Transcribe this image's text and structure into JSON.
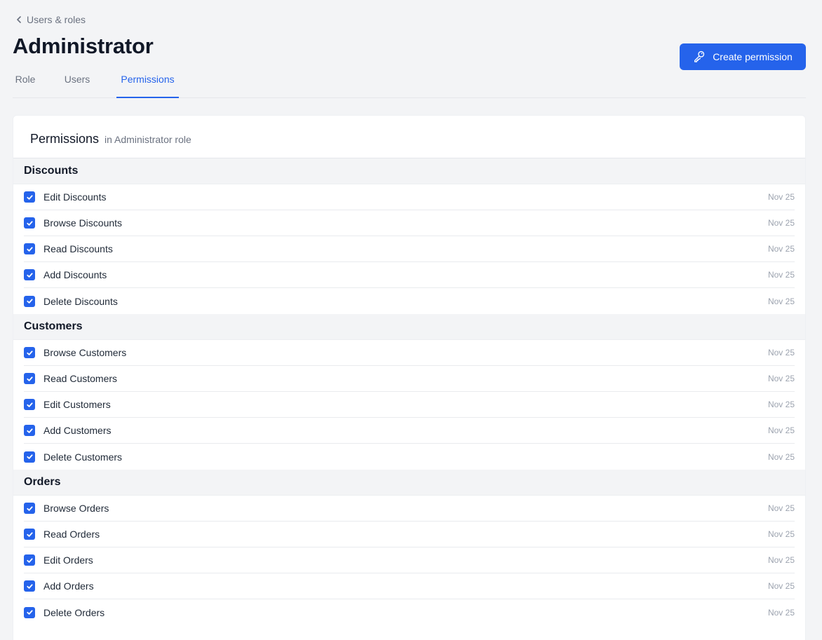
{
  "breadcrumb": {
    "label": "Users & roles"
  },
  "header": {
    "title": "Administrator",
    "create_button_label": "Create permission"
  },
  "tabs": [
    {
      "label": "Role",
      "active": false
    },
    {
      "label": "Users",
      "active": false
    },
    {
      "label": "Permissions",
      "active": true
    }
  ],
  "card": {
    "title": "Permissions",
    "subtitle": "in Administrator role"
  },
  "accent_color": "#2563eb",
  "groups": [
    {
      "name": "Discounts",
      "permissions": [
        {
          "label": "Edit Discounts",
          "date": "Nov 25",
          "checked": true
        },
        {
          "label": "Browse Discounts",
          "date": "Nov 25",
          "checked": true
        },
        {
          "label": "Read Discounts",
          "date": "Nov 25",
          "checked": true
        },
        {
          "label": "Add Discounts",
          "date": "Nov 25",
          "checked": true
        },
        {
          "label": "Delete Discounts",
          "date": "Nov 25",
          "checked": true
        }
      ]
    },
    {
      "name": "Customers",
      "permissions": [
        {
          "label": "Browse Customers",
          "date": "Nov 25",
          "checked": true
        },
        {
          "label": "Read Customers",
          "date": "Nov 25",
          "checked": true
        },
        {
          "label": "Edit Customers",
          "date": "Nov 25",
          "checked": true
        },
        {
          "label": "Add Customers",
          "date": "Nov 25",
          "checked": true
        },
        {
          "label": "Delete Customers",
          "date": "Nov 25",
          "checked": true
        }
      ]
    },
    {
      "name": "Orders",
      "permissions": [
        {
          "label": "Browse Orders",
          "date": "Nov 25",
          "checked": true
        },
        {
          "label": "Read Orders",
          "date": "Nov 25",
          "checked": true
        },
        {
          "label": "Edit Orders",
          "date": "Nov 25",
          "checked": true
        },
        {
          "label": "Add Orders",
          "date": "Nov 25",
          "checked": true
        },
        {
          "label": "Delete Orders",
          "date": "Nov 25",
          "checked": true
        }
      ]
    }
  ]
}
